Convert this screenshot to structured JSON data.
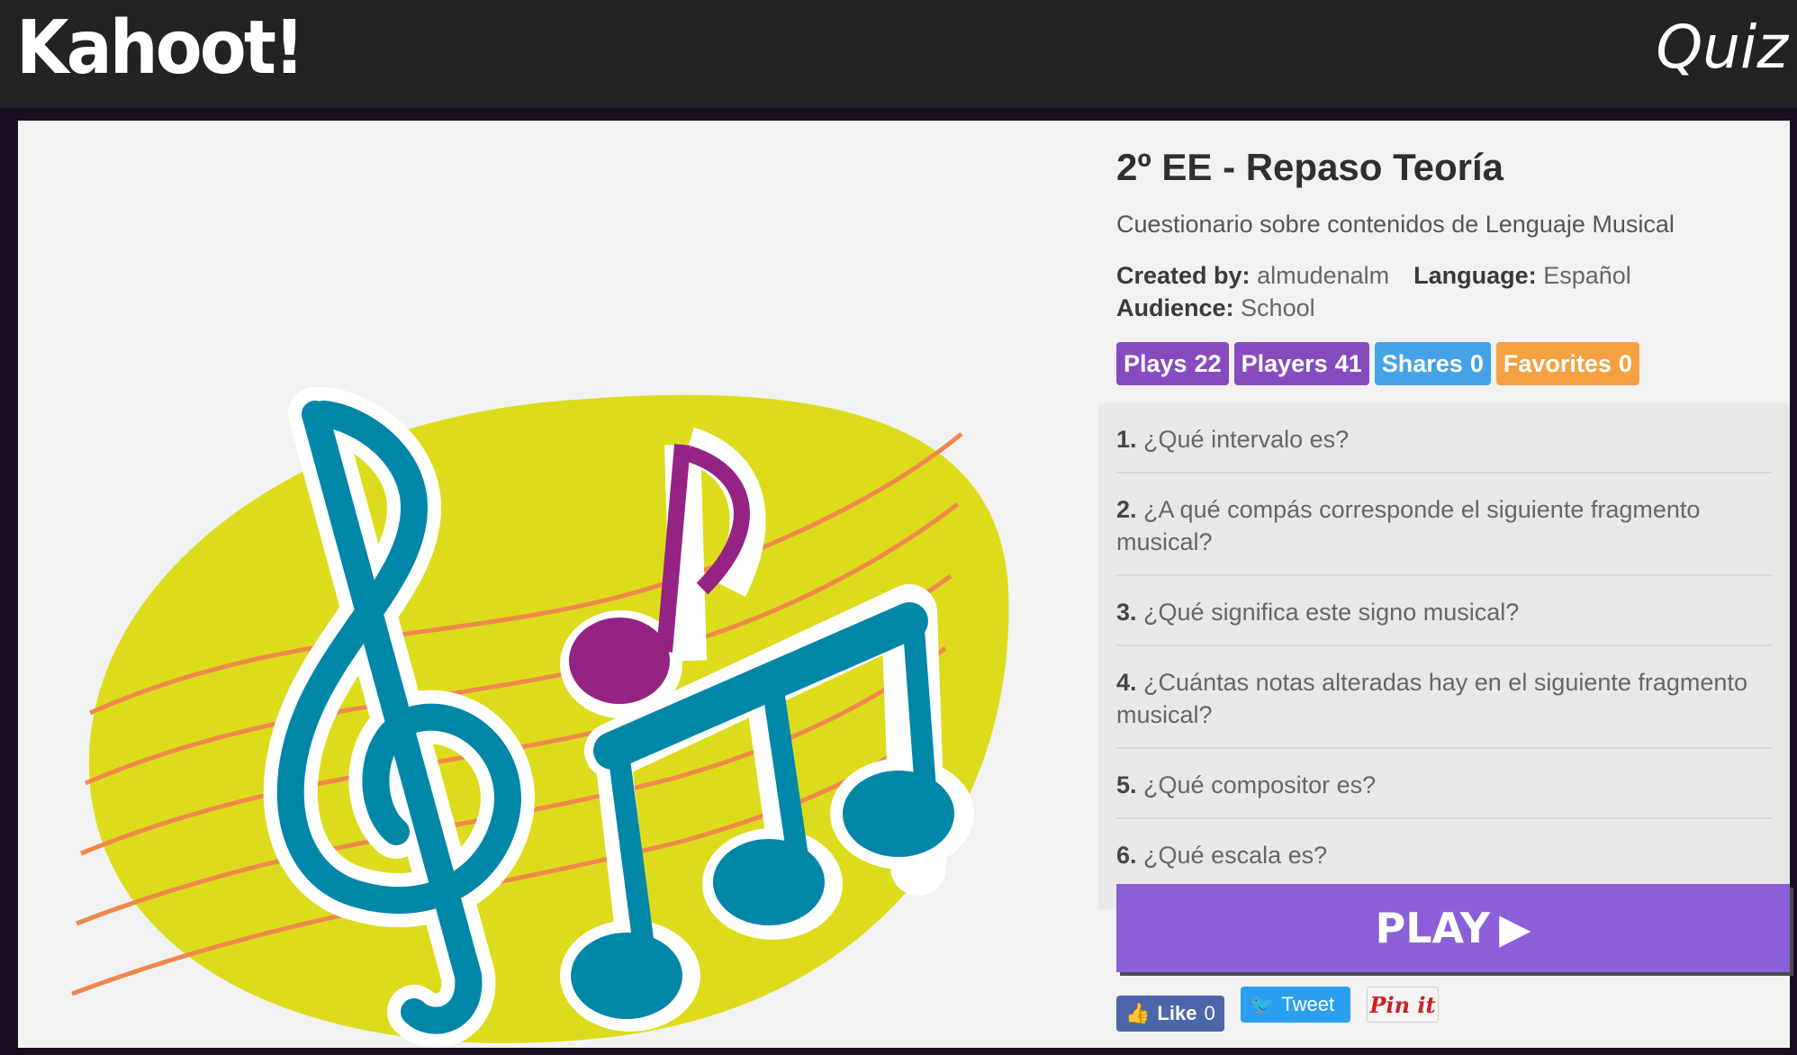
{
  "header": {
    "logo_text": "Kahoot!",
    "title": "Quiz"
  },
  "quiz": {
    "title": "2º EE - Repaso Teoría",
    "description": "Cuestionario sobre contenidos de Lenguaje Musical",
    "created_by_label": "Created by:",
    "created_by": "almudenalm",
    "language_label": "Language:",
    "language": "Español",
    "audience_label": "Audience:",
    "audience": "School"
  },
  "stats": [
    {
      "label": "Plays",
      "value": "22",
      "color": "#864cbf"
    },
    {
      "label": "Players",
      "value": "41",
      "color": "#864cbf"
    },
    {
      "label": "Shares",
      "value": "0",
      "color": "#45a3e5"
    },
    {
      "label": "Favorites",
      "value": "0",
      "color": "#f4a142"
    }
  ],
  "questions": [
    {
      "num": "1.",
      "text": "¿Qué intervalo es?"
    },
    {
      "num": "2.",
      "text": "¿A qué compás corresponde el siguiente fragmento musical?"
    },
    {
      "num": "3.",
      "text": "¿Qué significa este signo musical?"
    },
    {
      "num": "4.",
      "text": "¿Cuántas notas alteradas hay en el siguiente fragmento musical?"
    },
    {
      "num": "5.",
      "text": "¿Qué compositor es?"
    },
    {
      "num": "6.",
      "text": "¿Qué escala es?"
    }
  ],
  "play_button": "PLAY",
  "social": {
    "like_label": "Like",
    "like_count": "0",
    "tweet_label": "Tweet",
    "pin_label": "Pin it"
  },
  "colors": {
    "header_bg": "#232323",
    "play": "#8a5fd8",
    "art_yellow": "#dcdc1c",
    "art_teal": "#0087a8",
    "art_magenta": "#942383",
    "art_lines": "#f0884c"
  }
}
